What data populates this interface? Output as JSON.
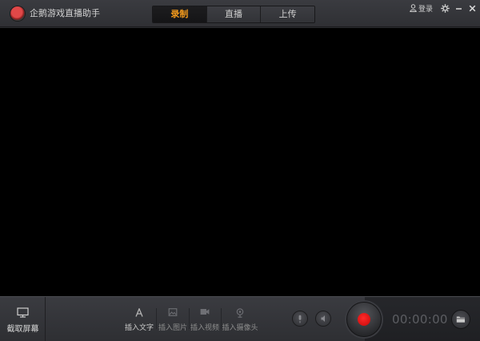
{
  "app": {
    "title": "企鹅游戏直播助手",
    "logo_icon": "penguin-logo-icon"
  },
  "mode_tabs": [
    {
      "label": "录制",
      "active": true
    },
    {
      "label": "直播",
      "active": false
    },
    {
      "label": "上传",
      "active": false
    }
  ],
  "header": {
    "login_label": "登录"
  },
  "toolbar": {
    "capture_label": "截取屏幕",
    "tools": [
      {
        "label": "插入文字",
        "icon": "text-icon"
      },
      {
        "label": "插入图片",
        "icon": "image-icon"
      },
      {
        "label": "插入视频",
        "icon": "video-icon"
      },
      {
        "label": "插入摄像头",
        "icon": "camera-icon"
      }
    ],
    "timer": "00:00:00"
  },
  "colors": {
    "accent": "#f39a1c",
    "record": "#e01010",
    "preview": "#000000"
  }
}
